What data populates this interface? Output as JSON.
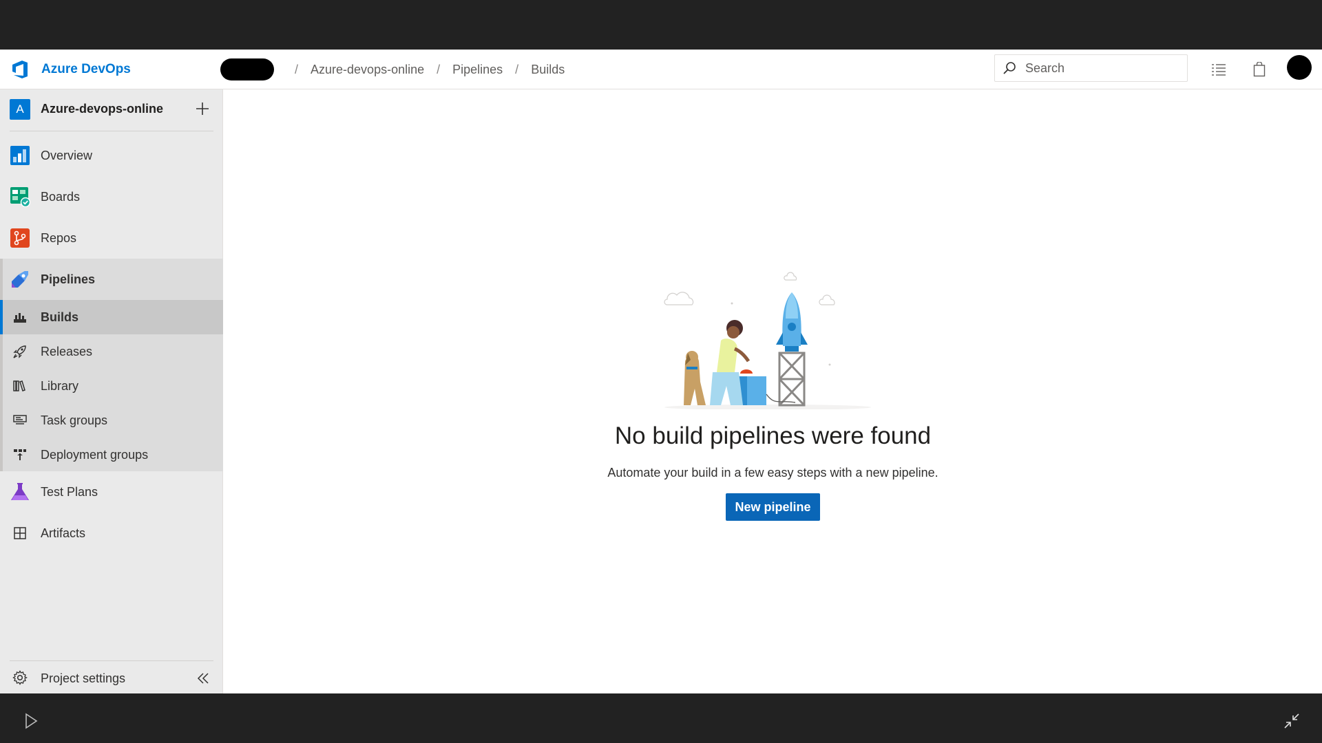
{
  "header": {
    "brand_name": "Azure DevOps",
    "breadcrumb": [
      "Azure-devops-online",
      "Pipelines",
      "Builds"
    ],
    "search_placeholder": "Search"
  },
  "sidebar": {
    "project_initial": "A",
    "project_name": "Azure-devops-online",
    "items": [
      {
        "label": "Overview",
        "icon": "overview-icon"
      },
      {
        "label": "Boards",
        "icon": "boards-icon"
      },
      {
        "label": "Repos",
        "icon": "repos-icon"
      },
      {
        "label": "Pipelines",
        "icon": "pipelines-icon"
      },
      {
        "label": "Builds",
        "icon": "builds-icon"
      },
      {
        "label": "Releases",
        "icon": "rocket-icon"
      },
      {
        "label": "Library",
        "icon": "library-icon"
      },
      {
        "label": "Task groups",
        "icon": "task-groups-icon"
      },
      {
        "label": "Deployment groups",
        "icon": "deployment-groups-icon"
      },
      {
        "label": "Test Plans",
        "icon": "flask-icon"
      },
      {
        "label": "Artifacts",
        "icon": "artifacts-icon"
      }
    ],
    "project_settings": "Project settings"
  },
  "main": {
    "empty_title": "No build pipelines were found",
    "empty_subtitle": "Automate your build in a few easy steps with a new pipeline.",
    "new_pipeline_label": "New pipeline"
  },
  "colors": {
    "brand": "#0078d4",
    "primary_button": "#0a66b7",
    "sidebar_bg": "#eaeaea"
  }
}
